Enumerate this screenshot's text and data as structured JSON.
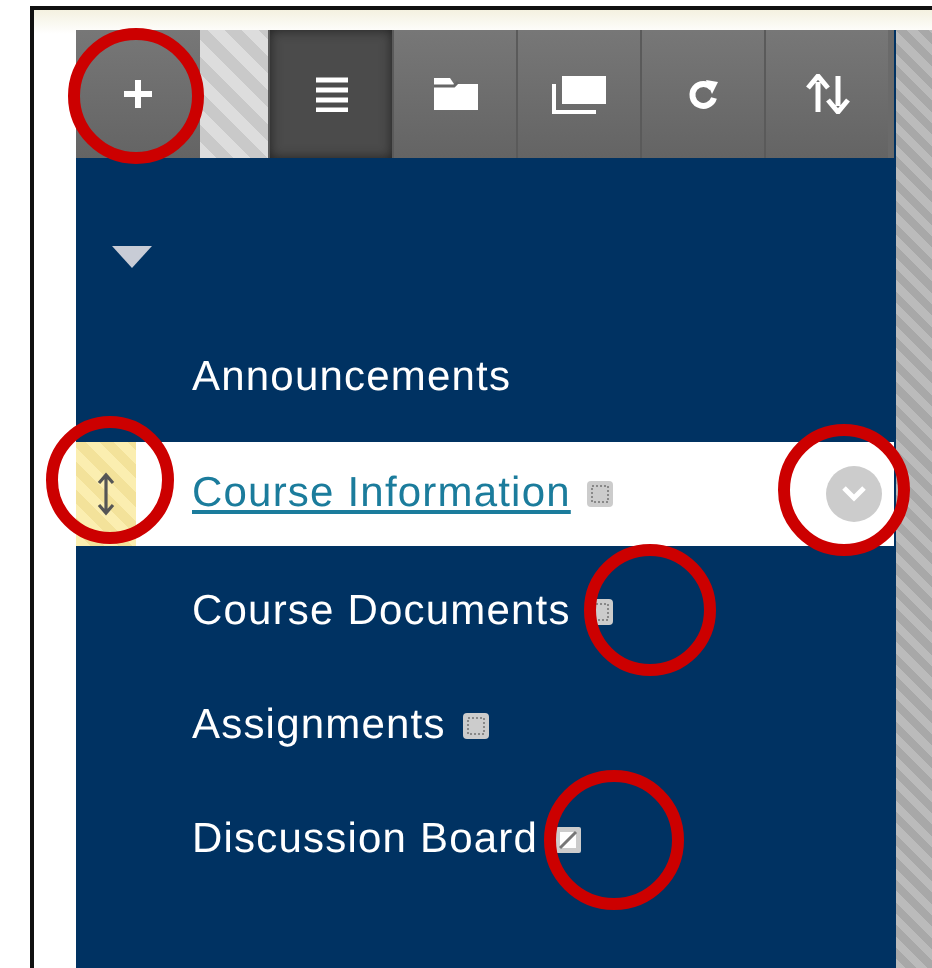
{
  "toolbar": [
    {
      "kind": "add",
      "selected": false
    },
    {
      "kind": "list",
      "selected": true
    },
    {
      "kind": "folder",
      "selected": false
    },
    {
      "kind": "windows",
      "selected": false
    },
    {
      "kind": "refresh",
      "selected": false
    },
    {
      "kind": "sort",
      "selected": false
    }
  ],
  "menu": {
    "expanded": true,
    "items": [
      {
        "label": "Announcements",
        "selected": false,
        "kind": "plain"
      },
      {
        "label": "Course Information",
        "selected": true,
        "kind": "hidden"
      },
      {
        "label": "Course Documents",
        "selected": false,
        "kind": "hidden"
      },
      {
        "label": "Assignments",
        "selected": false,
        "kind": "hidden"
      },
      {
        "label": "Discussion Board",
        "selected": false,
        "kind": "unavailable"
      }
    ]
  }
}
